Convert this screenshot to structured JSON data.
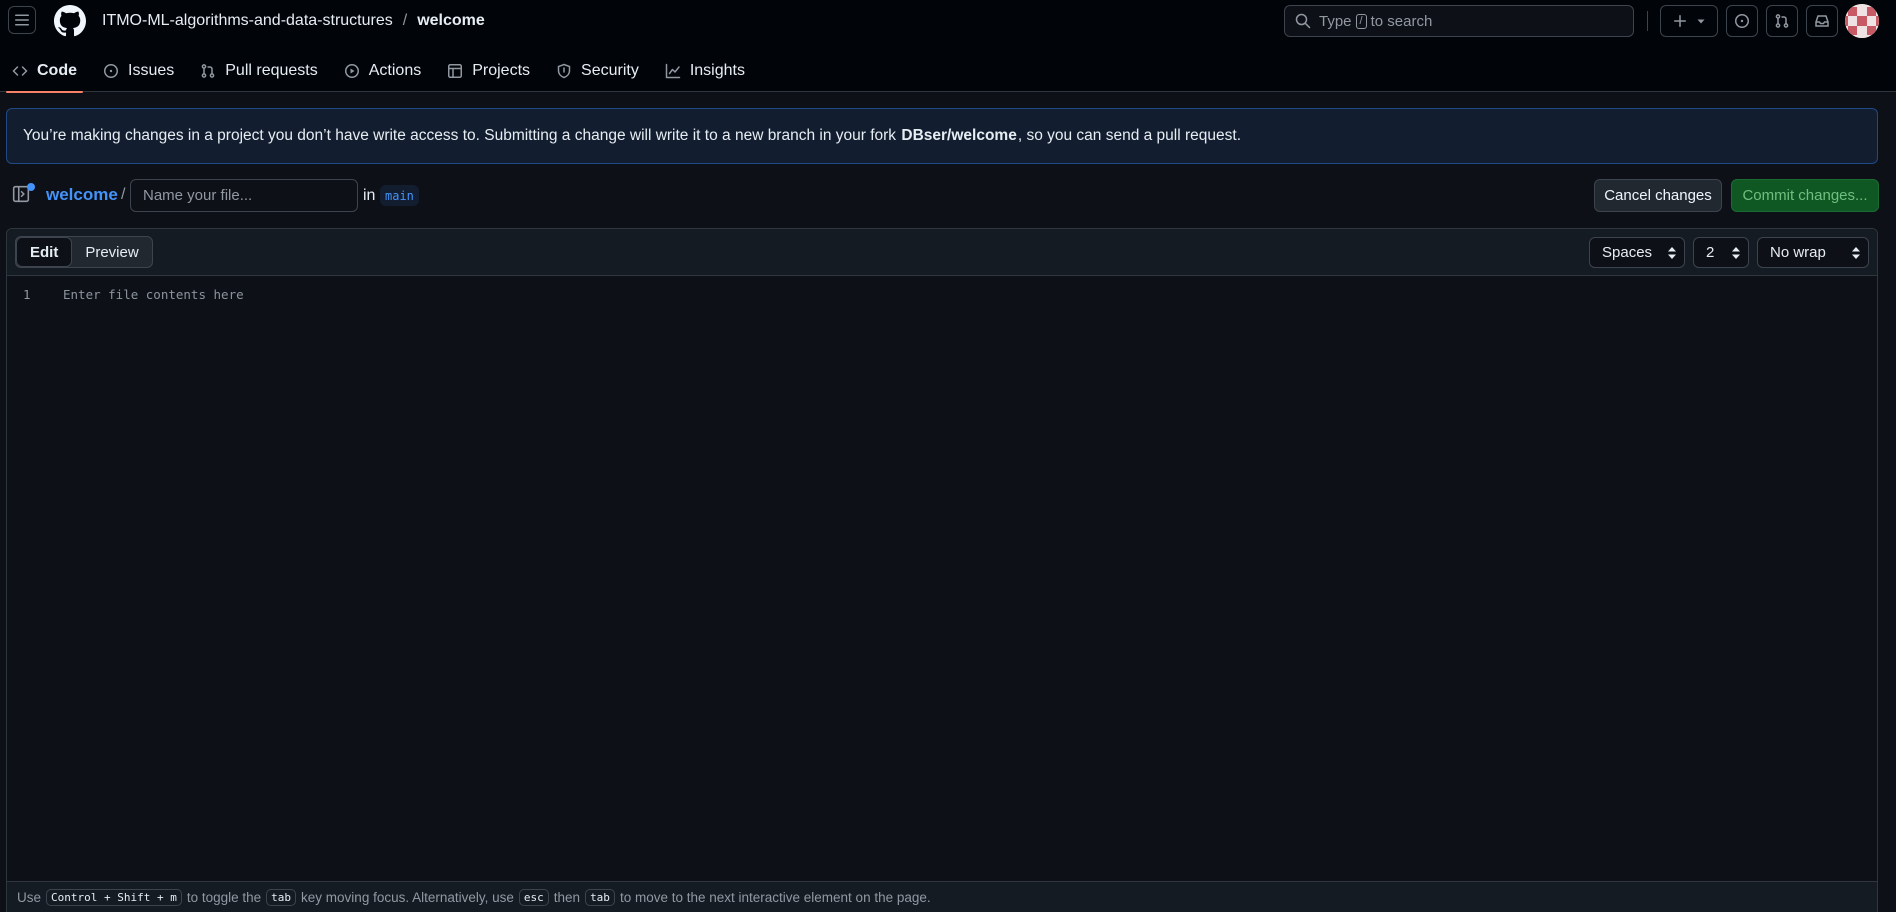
{
  "header": {
    "owner": "ITMO-ML-algorithms-and-data-structures",
    "separator": "/",
    "repo": "welcome",
    "search": {
      "prefix": "Type",
      "key": "/",
      "suffix": "to search"
    },
    "icons": [
      "menu-icon",
      "github-logo",
      "search-icon",
      "plus-icon",
      "chevron-down-icon",
      "issue-icon",
      "pull-request-icon",
      "inbox-icon",
      "avatar"
    ]
  },
  "tabs": [
    {
      "label": "Code",
      "icon": "code-icon",
      "active": true
    },
    {
      "label": "Issues",
      "icon": "issue-opened-icon",
      "active": false
    },
    {
      "label": "Pull requests",
      "icon": "git-pull-request-icon",
      "active": false
    },
    {
      "label": "Actions",
      "icon": "play-icon",
      "active": false
    },
    {
      "label": "Projects",
      "icon": "table-icon",
      "active": false
    },
    {
      "label": "Security",
      "icon": "shield-icon",
      "active": false
    },
    {
      "label": "Insights",
      "icon": "graph-icon",
      "active": false
    }
  ],
  "banner": {
    "before": "You’re making changes in a project you don’t have write access to. Submitting a change will write it to a new branch in your fork",
    "fork": "DBser/welcome",
    "after": ", so you can send a pull request."
  },
  "filebar": {
    "repo_link": "welcome",
    "separator": "/",
    "name_placeholder": "Name your file...",
    "name_value": "",
    "in_label": "in",
    "branch": "main",
    "cancel_label": "Cancel changes",
    "commit_label": "Commit changes..."
  },
  "editor": {
    "edit_label": "Edit",
    "preview_label": "Preview",
    "indent_mode": "Spaces",
    "indent_size": "2",
    "wrap_mode": "No wrap",
    "line_number": "1",
    "content_placeholder": "Enter file contents here"
  },
  "footer": {
    "t1": "Use",
    "k1": "Control + Shift + m",
    "t2": "to toggle the",
    "k2": "tab",
    "t3": "key moving focus. Alternatively, use",
    "k3": "esc",
    "t4": "then",
    "k4": "tab",
    "t5": "to move to the next interactive element on the page."
  },
  "colors": {
    "background": "#0d1117",
    "header_bg": "#010409",
    "accent_link": "#4493f8",
    "active_tab_underline": "#f78166",
    "commit_button": "#105823"
  }
}
